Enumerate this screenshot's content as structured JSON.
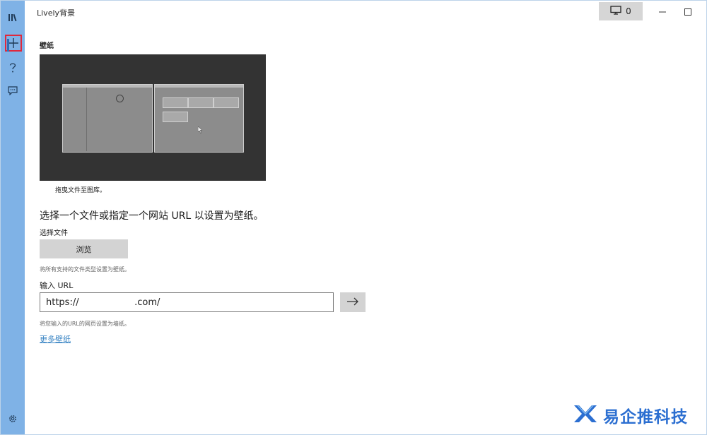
{
  "window": {
    "title": "Lively背景"
  },
  "nav": {
    "items": [
      {
        "name": "library",
        "icon": "library-icon"
      },
      {
        "name": "add",
        "icon": "plus-icon",
        "selected": true
      },
      {
        "name": "help",
        "icon": "help-icon"
      },
      {
        "name": "feedback",
        "icon": "chat-icon"
      }
    ],
    "settings_icon": "gear-icon"
  },
  "titlebar": {
    "monitor_count": "0"
  },
  "content": {
    "section_title": "壁纸",
    "preview_caption": "拖曳文件至图库。",
    "heading": "选择一个文件或指定一个网站 URL 以设置为壁纸。",
    "file_label": "选择文件",
    "browse_label": "浏览",
    "file_hint": "将所有支持的文件类型设置为壁纸。",
    "url_label": "输入 URL",
    "url_value": "https://                   .com/",
    "url_hint": "将您输入的URL的网页设置为墙纸。",
    "more_link": "更多壁纸"
  },
  "watermark": {
    "text": "易企推科技"
  },
  "colors": {
    "nav_bg": "#7fb2e6",
    "highlight_border": "#e0283c",
    "link": "#3a85c4",
    "preview_bg": "#333333",
    "watermark": "#2c6fd1"
  }
}
